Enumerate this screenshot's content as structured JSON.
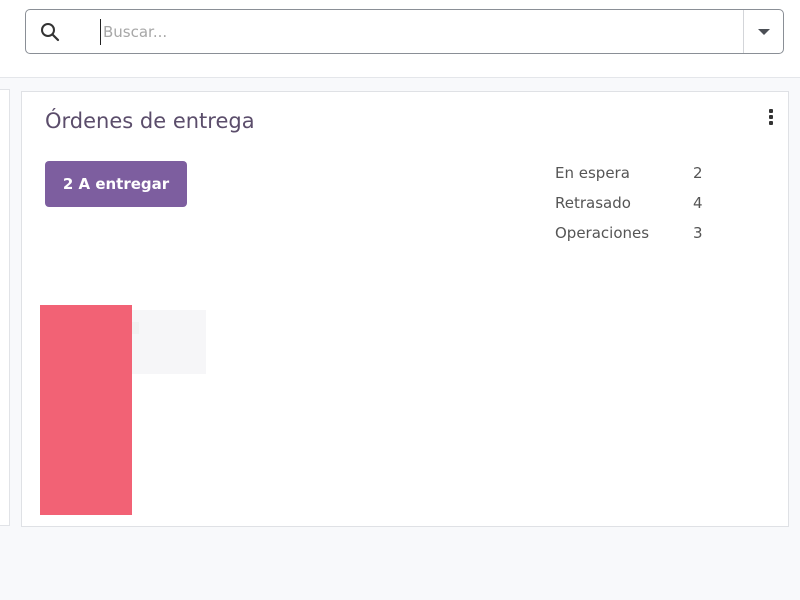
{
  "search": {
    "placeholder": "Buscar..."
  },
  "card": {
    "title": "Órdenes de entrega",
    "primary_button": "2 A entregar",
    "stats": [
      {
        "label": "En espera",
        "value": "2"
      },
      {
        "label": "Retrasado",
        "value": "4"
      },
      {
        "label": "Operaciones",
        "value": "3"
      }
    ]
  },
  "colors": {
    "accent": "#7d5e9f",
    "alert": "#f26275"
  },
  "icons": {
    "search": "search-icon",
    "dropdown": "chevron-down-icon",
    "menu": "kebab-menu-icon"
  }
}
